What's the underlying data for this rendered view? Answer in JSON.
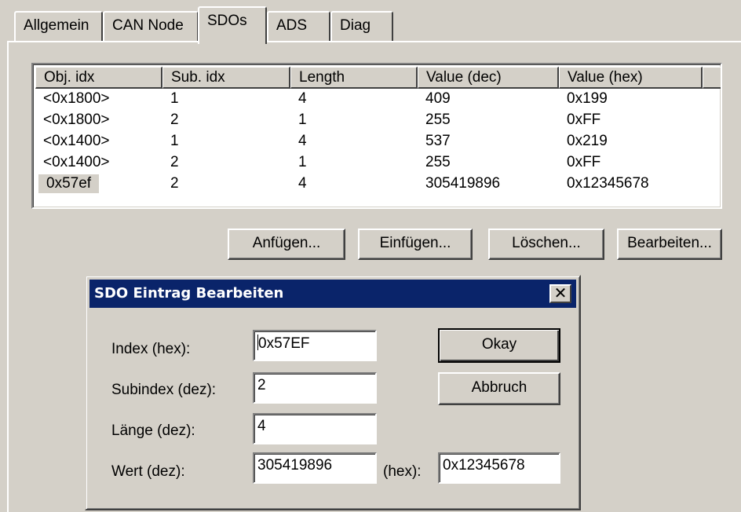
{
  "tabs": [
    {
      "label": "Allgemein"
    },
    {
      "label": "CAN Node"
    },
    {
      "label": "SDOs"
    },
    {
      "label": "ADS"
    },
    {
      "label": "Diag"
    }
  ],
  "active_tab": "SDOs",
  "list": {
    "columns": [
      "Obj. idx",
      "Sub. idx",
      "Length",
      "Value (dec)",
      "Value (hex)",
      ""
    ],
    "rows": [
      [
        "<0x1800>",
        "1",
        "4",
        "409",
        "0x199"
      ],
      [
        "<0x1800>",
        "2",
        "1",
        "255",
        "0xFF"
      ],
      [
        "<0x1400>",
        "1",
        "4",
        "537",
        "0x219"
      ],
      [
        "<0x1400>",
        "2",
        "1",
        "255",
        "0xFF"
      ],
      [
        "0x57ef",
        "2",
        "4",
        "305419896",
        "0x12345678"
      ]
    ],
    "selected_row": 4
  },
  "buttons": {
    "append": "Anfügen...",
    "insert": "Einfügen...",
    "delete": "Löschen...",
    "edit": "Bearbeiten..."
  },
  "dialog": {
    "title": "SDO Eintrag Bearbeiten",
    "close_symbol": "✕",
    "index_label": "Index (hex):",
    "index_value": "0x57EF",
    "subindex_label": "Subindex (dez):",
    "subindex_value": "2",
    "length_label": "Länge (dez):",
    "length_value": "4",
    "value_label": "Wert (dez):",
    "value_dec": "305419896",
    "hex_label": "(hex):",
    "value_hex": "0x12345678",
    "okay": "Okay",
    "cancel": "Abbruch"
  }
}
